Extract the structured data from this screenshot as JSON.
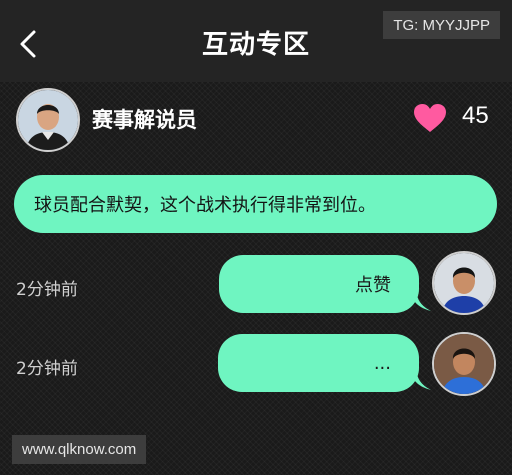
{
  "header": {
    "title": "互动专区",
    "back_icon": "chevron-left-icon"
  },
  "watermark_top": "TG: MYYJJPP",
  "post": {
    "author_name": "赛事解说员",
    "like_icon": "heart-icon",
    "like_count": "45",
    "message": "球员配合默契，这个战术执行得非常到位。"
  },
  "replies": [
    {
      "time": "2分钟前",
      "text": "点赞"
    },
    {
      "time": "2分钟前",
      "text": "..."
    }
  ],
  "watermark_bottom": "www.qlknow.com",
  "colors": {
    "bubble": "#6ff5c1",
    "heart": "#ff5aa0",
    "header_bg": "#242424",
    "page_bg": "#1a1a1a"
  }
}
